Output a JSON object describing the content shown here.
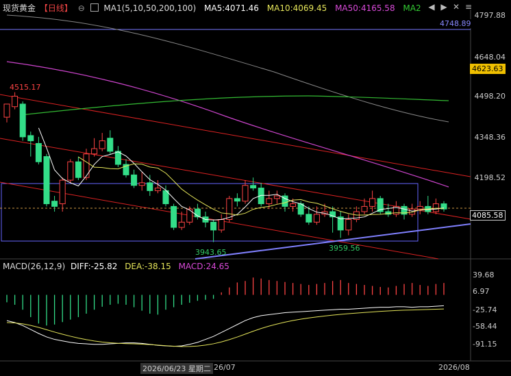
{
  "header": {
    "title": "现货黄金",
    "period": "【日线】",
    "ma_label": "MA1(5,10,50,200,100)",
    "ma5": "MA5:4071.46",
    "ma10": "MA10:4069.45",
    "ma50": "MA50:4165.58",
    "ma2": "MA2",
    "colors": {
      "ma5": "#ffffff",
      "ma10": "#e6e65a",
      "ma50": "#d94ad9",
      "ma2": "#33cc33"
    }
  },
  "macd_header": {
    "label": "MACD(26,12,9)",
    "diff": "DIFF:-25.82",
    "dea": "DEA:-38.15",
    "macd": "MACD:24.65"
  },
  "price_axis": [
    "4797.88",
    "4648.04",
    "4498.20",
    "4348.36",
    "4198.52"
  ],
  "macd_axis": [
    "39.68",
    "6.97",
    "-25.74",
    "-58.44",
    "-91.15"
  ],
  "price_tags": {
    "upper": "4748.89",
    "ma_level": "4623.63",
    "last": "4085.58"
  },
  "annotations": {
    "high": "4515.17",
    "low1": "3943.65",
    "low2": "3959.56"
  },
  "x_labels": {
    "cursor": "2026/06/23 星期二",
    "mid": "26/07",
    "end": "2026/08"
  },
  "icons": [
    "nav-left-icon",
    "nav-right-icon",
    "close-icon",
    "menu-icon"
  ],
  "chart_data": {
    "type": "candlestick",
    "ylim": [
      3880,
      4830
    ],
    "candles": [
      [
        4420,
        4470,
        4470,
        4400
      ],
      [
        4460,
        4500,
        4515,
        4450
      ],
      [
        4470,
        4345,
        4480,
        4330
      ],
      [
        4350,
        4330,
        4365,
        4270
      ],
      [
        4320,
        4250,
        4345,
        4240
      ],
      [
        4270,
        4090,
        4280,
        4080
      ],
      [
        4100,
        4080,
        4120,
        4060
      ],
      [
        4090,
        4180,
        4190,
        4060
      ],
      [
        4180,
        4250,
        4260,
        4170
      ],
      [
        4250,
        4190,
        4270,
        4180
      ],
      [
        4190,
        4280,
        4300,
        4180
      ],
      [
        4280,
        4300,
        4340,
        4270
      ],
      [
        4300,
        4330,
        4360,
        4290
      ],
      [
        4340,
        4290,
        4370,
        4280
      ],
      [
        4290,
        4240,
        4310,
        4230
      ],
      [
        4240,
        4200,
        4260,
        4190
      ],
      [
        4200,
        4160,
        4220,
        4150
      ],
      [
        4160,
        4170,
        4210,
        4140
      ],
      [
        4170,
        4140,
        4200,
        4120
      ],
      [
        4140,
        4150,
        4180,
        4130
      ],
      [
        4140,
        4090,
        4160,
        4080
      ],
      [
        4080,
        4000,
        4090,
        3990
      ],
      [
        4000,
        4020,
        4060,
        3990
      ],
      [
        4020,
        4070,
        4080,
        4010
      ],
      [
        4070,
        4040,
        4090,
        4030
      ],
      [
        4040,
        4020,
        4060,
        4000
      ],
      [
        4020,
        3990,
        4030,
        3944
      ],
      [
        3990,
        4030,
        4050,
        3980
      ],
      [
        4030,
        4110,
        4120,
        4020
      ],
      [
        4110,
        4100,
        4130,
        4080
      ],
      [
        4100,
        4160,
        4180,
        4090
      ],
      [
        4160,
        4150,
        4190,
        4140
      ],
      [
        4150,
        4090,
        4170,
        4080
      ],
      [
        4090,
        4110,
        4140,
        4070
      ],
      [
        4110,
        4120,
        4140,
        4090
      ],
      [
        4120,
        4080,
        4130,
        4060
      ],
      [
        4080,
        4090,
        4110,
        4060
      ],
      [
        4090,
        4050,
        4100,
        4040
      ],
      [
        4050,
        4020,
        4080,
        4010
      ],
      [
        4020,
        4050,
        4080,
        4010
      ],
      [
        4050,
        4060,
        4090,
        4040
      ],
      [
        4060,
        4040,
        4080,
        3980
      ],
      [
        4040,
        3990,
        4060,
        3960
      ],
      [
        3990,
        4030,
        4050,
        3970
      ],
      [
        4030,
        4060,
        4080,
        4020
      ],
      [
        4060,
        4080,
        4110,
        4050
      ],
      [
        4080,
        4110,
        4140,
        4060
      ],
      [
        4110,
        4060,
        4120,
        4050
      ],
      [
        4060,
        4050,
        4090,
        4040
      ],
      [
        4050,
        4080,
        4100,
        4040
      ],
      [
        4080,
        4050,
        4090,
        4030
      ],
      [
        4050,
        4070,
        4090,
        4040
      ],
      [
        4070,
        4080,
        4100,
        4050
      ],
      [
        4080,
        4060,
        4120,
        4050
      ],
      [
        4060,
        4090,
        4110,
        4050
      ],
      [
        4090,
        4070,
        4100,
        4060
      ]
    ],
    "macd_hist": [
      -15,
      -20,
      -30,
      -45,
      -58,
      -62,
      -60,
      -55,
      -50,
      -45,
      -38,
      -30,
      -24,
      -20,
      -18,
      -20,
      -25,
      -32,
      -38,
      -40,
      -30,
      -25,
      -20,
      -16,
      -12,
      -10,
      -8,
      5,
      15,
      25,
      28,
      35,
      33,
      30,
      28,
      26,
      24,
      22,
      20,
      22,
      24,
      28,
      30,
      24,
      22,
      20,
      18,
      16,
      15,
      18,
      22,
      24,
      20,
      18,
      22,
      24
    ],
    "macd_diff": [
      -52,
      -56,
      -62,
      -70,
      -78,
      -85,
      -90,
      -93,
      -96,
      -98,
      -99,
      -100,
      -100,
      -99,
      -98,
      -97,
      -97,
      -98,
      -100,
      -102,
      -103,
      -104,
      -103,
      -100,
      -96,
      -90,
      -84,
      -76,
      -68,
      -60,
      -52,
      -46,
      -42,
      -40,
      -38,
      -36,
      -35,
      -34,
      -33,
      -32,
      -31,
      -30,
      -29,
      -29,
      -28,
      -27,
      -26,
      -25,
      -25,
      -24,
      -24,
      -25,
      -24,
      -24,
      -23,
      -22
    ]
  }
}
